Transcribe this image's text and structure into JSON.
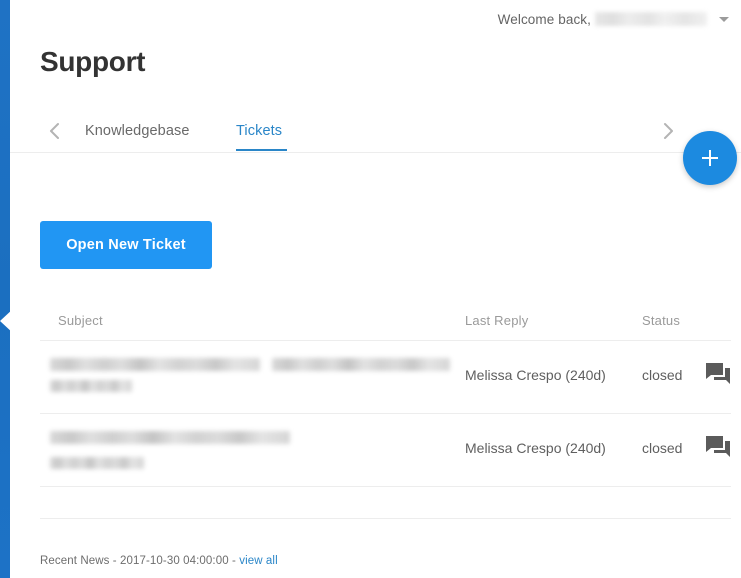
{
  "header": {
    "welcome_text": "Welcome back,",
    "username_redacted": true,
    "caret_icon": "chevron-down-icon"
  },
  "page_title": "Support",
  "tabs": {
    "prev_icon": "chevron-left-icon",
    "next_icon": "chevron-right-icon",
    "items": [
      {
        "label": "Knowledgebase",
        "active": false
      },
      {
        "label": "Tickets",
        "active": true
      }
    ],
    "active_color": "#2a86c8"
  },
  "fab": {
    "icon": "plus-icon",
    "color": "#1c8ae0",
    "label": "+"
  },
  "actions": {
    "open_new_ticket": "Open New Ticket",
    "button_color": "#2196f3"
  },
  "table": {
    "columns": [
      "Subject",
      "Last Reply",
      "Status"
    ],
    "rows": [
      {
        "subject_redacted": true,
        "subject_line1_width": 210,
        "subject_line2_width": 178,
        "subject_line3_width": 82,
        "last_reply": "Melissa Crespo (240d)",
        "status": "closed",
        "action_icon": "forum-icon"
      },
      {
        "subject_redacted": true,
        "subject_line1_width": 240,
        "subject_line2_width": 0,
        "subject_line3_width": 94,
        "last_reply": "Melissa Crespo (240d)",
        "status": "closed",
        "action_icon": "forum-icon"
      }
    ]
  },
  "footer": {
    "news_prefix": "Recent News - 2017-10-30 04:00:00 - ",
    "news_link": "view all"
  },
  "colors": {
    "rail": "#1b6fc0",
    "accent": "#2196f3",
    "link": "#2a86c8",
    "divider": "#ededed"
  }
}
